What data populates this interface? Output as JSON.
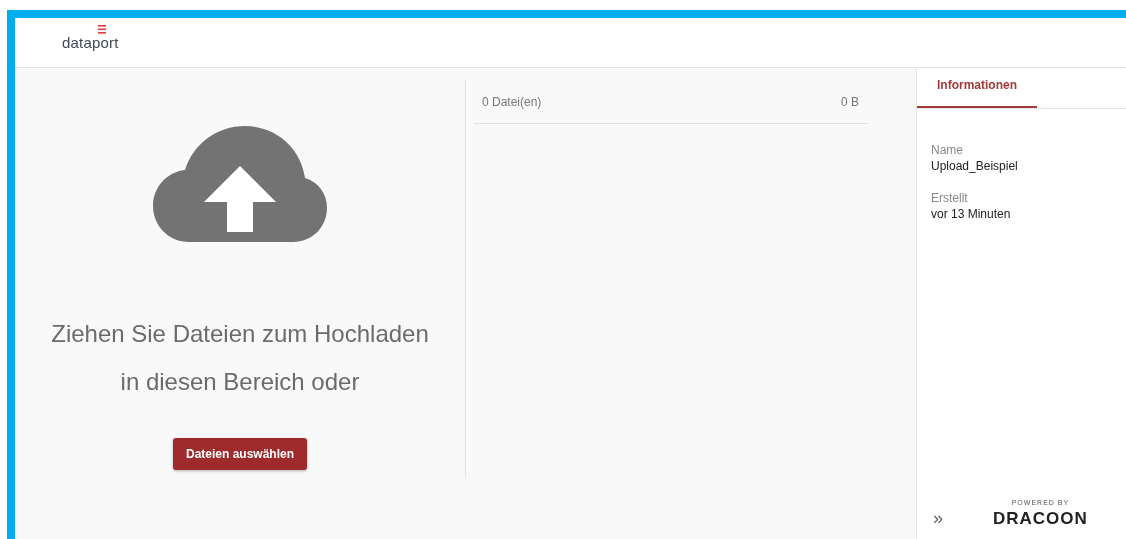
{
  "header": {
    "logo": "dataport"
  },
  "upload": {
    "prompt_lines": [
      "Ziehen Sie Dateien zum Hochladen",
      "in diesen Bereich oder"
    ],
    "button": "Dateien auswählen"
  },
  "file_list": {
    "count": "0 Datei(en)",
    "size": "0 B"
  },
  "info_panel": {
    "tabs": [
      {
        "label": "Informationen",
        "selected": true
      }
    ],
    "fields": [
      {
        "label": "Name",
        "value": "Upload_Beispiel"
      },
      {
        "label": "Erstellt",
        "value": "vor 13 Minuten"
      }
    ],
    "expand": "»",
    "powered_by": "POWERED BY",
    "brand": "DRACOON"
  }
}
